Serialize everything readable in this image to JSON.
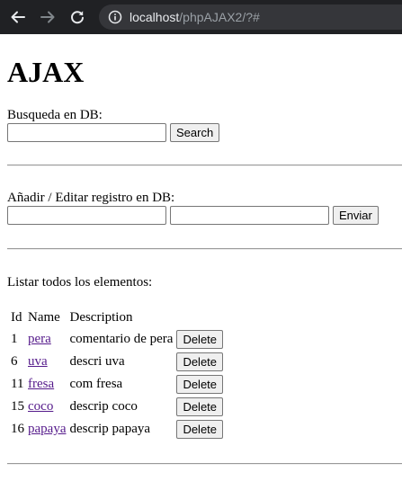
{
  "browser": {
    "url_host": "localhost",
    "url_path": "/phpAJAX2/?#"
  },
  "page": {
    "title": "AJAX",
    "search": {
      "label": "Busqueda en DB:",
      "value": "",
      "button": "Search"
    },
    "edit": {
      "label": "Añadir / Editar registro en DB:",
      "name_value": "",
      "description_value": "",
      "button": "Enviar"
    },
    "list": {
      "label": "Listar todos los elementos:",
      "headers": {
        "id": "Id",
        "name": "Name",
        "description": "Description"
      },
      "delete_label": "Delete",
      "rows": [
        {
          "id": "1",
          "name": "pera",
          "description": "comentario de pera"
        },
        {
          "id": "6",
          "name": "uva",
          "description": "descri uva"
        },
        {
          "id": "11",
          "name": "fresa",
          "description": "com fresa"
        },
        {
          "id": "15",
          "name": "coco",
          "description": "descrip coco"
        },
        {
          "id": "16",
          "name": "papaya",
          "description": "descrip papaya"
        }
      ]
    }
  }
}
